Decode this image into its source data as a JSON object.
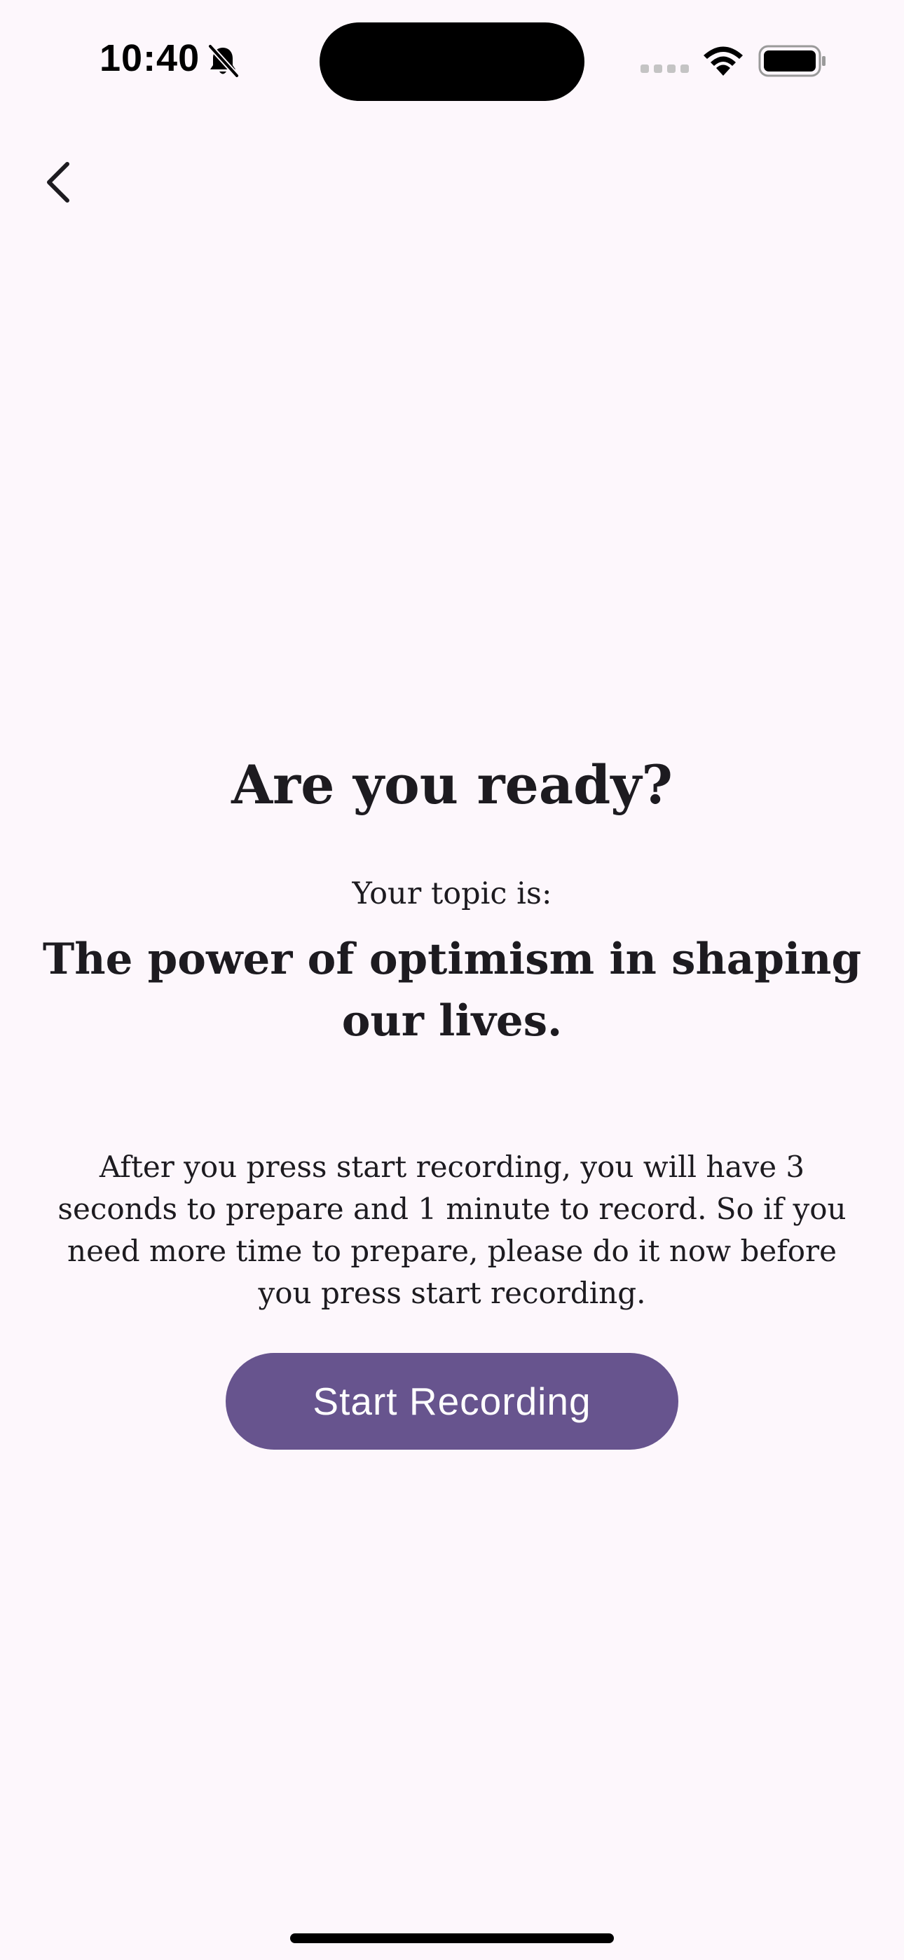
{
  "status_bar": {
    "time": "10:40",
    "icons": [
      "bell-slash-icon",
      "cellular-signal-icon",
      "wifi-icon",
      "battery-icon"
    ]
  },
  "nav": {
    "back_icon": "chevron-left-icon"
  },
  "main": {
    "title": "Are you ready?",
    "topic_label": "Your topic is:",
    "topic": "The power of optimism in shaping our lives.",
    "instructions": "After  you press start recording, you will have 3 seconds to prepare and 1 minute to record. So if you need more time to prepare, please do it now before you press start recording."
  },
  "actions": {
    "start_label": "Start Recording"
  },
  "colors": {
    "background": "#fdf7fc",
    "primary": "#67548e",
    "text": "#1d1b20"
  }
}
